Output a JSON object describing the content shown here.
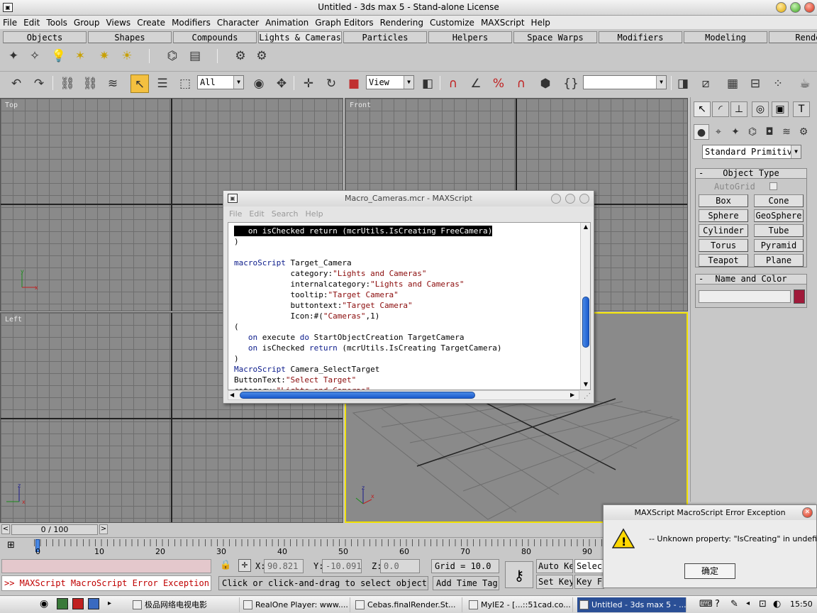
{
  "window": {
    "title": "Untitled - 3ds max 5 - Stand-alone License"
  },
  "menu": [
    "File",
    "Edit",
    "Tools",
    "Group",
    "Views",
    "Create",
    "Modifiers",
    "Character",
    "Animation",
    "Graph Editors",
    "Rendering",
    "Customize",
    "MAXScript",
    "Help"
  ],
  "tabs": [
    "Objects",
    "Shapes",
    "Compounds",
    "Lights & Cameras",
    "Particles",
    "Helpers",
    "Space Warps",
    "Modifiers",
    "Modeling",
    "Render"
  ],
  "active_tab": "Lights & Cameras",
  "toolbar": {
    "selection_filter": "All",
    "reference_coord": "View",
    "named_selection": ""
  },
  "viewports": {
    "top": "Top",
    "front": "Front",
    "left": "Left",
    "perspective": ""
  },
  "command_panel": {
    "category": "Standard Primitiv",
    "object_type_title": "Object Type",
    "autogrid": "AutoGrid",
    "buttons": [
      "Box",
      "Cone",
      "Sphere",
      "GeoSphere",
      "Cylinder",
      "Tube",
      "Torus",
      "Pyramid",
      "Teapot",
      "Plane"
    ],
    "name_color_title": "Name and Color",
    "name_value": "",
    "color": "#a01a3a"
  },
  "maxscript_window": {
    "title": "Macro_Cameras.mcr - MAXScript",
    "menu": [
      "File",
      "Edit",
      "Search",
      "Help"
    ],
    "lines": [
      {
        "indent": "   ",
        "kw1": "on",
        "mid": " isChecked ",
        "kw2": "return",
        "rest": " (mcrUtils.IsCreating FreeCamera)",
        "highlight": true
      },
      {
        "text": ")"
      },
      {
        "text": ""
      },
      {
        "kw1": "macroScript",
        "rest": " Target_Camera"
      },
      {
        "indent": "            ",
        "rest": "category:",
        "str": "\"Lights and Cameras\""
      },
      {
        "indent": "            ",
        "rest": "internalcategory:",
        "str": "\"Lights and Cameras\""
      },
      {
        "indent": "            ",
        "rest": "tooltip:",
        "str": "\"Target Camera\""
      },
      {
        "indent": "            ",
        "rest": "buttontext:",
        "str": "\"Target Camera\""
      },
      {
        "indent": "            ",
        "rest": "Icon:#(",
        "str": "\"Cameras\"",
        "tail": ",1)"
      },
      {
        "text": "("
      },
      {
        "indent": "   ",
        "kw1": "on",
        "mid": " execute ",
        "kw2": "do",
        "rest": " StartObjectCreation TargetCamera"
      },
      {
        "indent": "   ",
        "kw1": "on",
        "mid": " isChecked ",
        "kw2": "return",
        "rest": " (mcrUtils.IsCreating TargetCamera)"
      },
      {
        "text": ")"
      },
      {
        "kw1": "MacroScript",
        "rest": " Camera_SelectTarget"
      },
      {
        "rest": "ButtonText:",
        "str": "\"Select Target\""
      },
      {
        "rest": "category:",
        "str": "\"Lights and Cameras\""
      }
    ]
  },
  "timeline": {
    "frame_readout": "0 / 100",
    "ticks": [
      "0",
      "10",
      "20",
      "30",
      "40",
      "50",
      "60",
      "70",
      "80",
      "90"
    ]
  },
  "status": {
    "listener_output": ">> MAXScript MacroScript Error Exception:",
    "x_label": "X:",
    "x_value": "90.821",
    "y_label": "Y:",
    "y_value": "-10.091",
    "z_label": "Z:",
    "z_value": "0.0",
    "grid": "Grid = 10.0",
    "prompt": "Click or click-and-drag to select objects",
    "add_time_tag": "Add Time Tag",
    "auto_key": "Auto Key",
    "set_key": "Set Key",
    "selected": "Selec",
    "key_filters": "Key F"
  },
  "error_dialog": {
    "title": "MAXScript MacroScript Error Exception",
    "message": "-- Unknown property: \"IsCreating\" in undefined",
    "ok_label": "确定"
  },
  "taskbar": {
    "items": [
      "极品网络电视电影",
      "RealOne Player: www....",
      "Cebas.finalRender.St...",
      "MyIE2 - [...::51cad.co...",
      "Untitled - 3ds max 5 - ..."
    ],
    "clock": "15:50"
  }
}
